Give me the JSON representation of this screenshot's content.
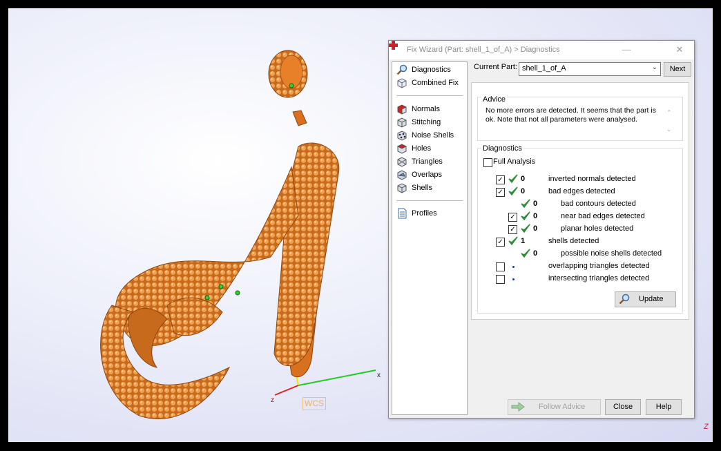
{
  "viewport": {
    "axis_x_label": "x",
    "axis_z_label": "z",
    "wcs_label": "WCS",
    "corner_label": "Z"
  },
  "dialog": {
    "title": "Fix Wizard (Part: shell_1_of_A) > Diagnostics",
    "minimize": "—",
    "close": "✕",
    "nav": [
      {
        "label": "Diagnostics",
        "icon": "magnifier-icon"
      },
      {
        "label": "Combined Fix",
        "icon": "cube-icon"
      },
      {
        "label": "Normals",
        "icon": "normals-cube-icon"
      },
      {
        "label": "Stitching",
        "icon": "stitching-cube-icon"
      },
      {
        "label": "Noise Shells",
        "icon": "noise-shells-icon"
      },
      {
        "label": "Holes",
        "icon": "holes-cube-icon"
      },
      {
        "label": "Triangles",
        "icon": "triangles-icon"
      },
      {
        "label": "Overlaps",
        "icon": "overlaps-icon"
      },
      {
        "label": "Shells",
        "icon": "shells-icon"
      },
      {
        "label": "Profiles",
        "icon": "document-icon"
      }
    ],
    "current_part_label": "Current Part:",
    "current_part_value": "shell_1_of_A",
    "next_button": "Next",
    "advice": {
      "title": "Advice",
      "text": "No more errors are detected. It seems that the part is ok. Note that not all parameters were analysed."
    },
    "diagnostics": {
      "title": "Diagnostics",
      "full_analysis_label": "Full Analysis",
      "full_analysis_checked": false,
      "rows": [
        {
          "checkbox": true,
          "checked": true,
          "status": "ok",
          "count": "0",
          "label": "inverted normals detected",
          "indent": 0
        },
        {
          "checkbox": true,
          "checked": true,
          "status": "ok",
          "count": "0",
          "label": "bad edges detected",
          "indent": 0
        },
        {
          "checkbox": false,
          "checked": false,
          "status": "ok",
          "count": "0",
          "label": "bad contours detected",
          "indent": 1
        },
        {
          "checkbox": true,
          "checked": true,
          "status": "ok",
          "count": "0",
          "label": "near bad edges detected",
          "indent": 1
        },
        {
          "checkbox": true,
          "checked": true,
          "status": "ok",
          "count": "0",
          "label": "planar holes detected",
          "indent": 1
        },
        {
          "checkbox": true,
          "checked": true,
          "status": "ok",
          "count": "1",
          "label": "shells detected",
          "indent": 0
        },
        {
          "checkbox": false,
          "checked": false,
          "status": "ok",
          "count": "0",
          "label": "possible noise shells detected",
          "indent": 1
        },
        {
          "checkbox": true,
          "checked": false,
          "status": "none",
          "count": "",
          "label": "overlapping triangles detected",
          "indent": 0
        },
        {
          "checkbox": true,
          "checked": false,
          "status": "none",
          "count": "",
          "label": "intersecting triangles detected",
          "indent": 0
        }
      ],
      "update_button": "Update"
    },
    "follow_advice_button": "Follow Advice",
    "close_button": "Close",
    "help_button": "Help"
  },
  "colors": {
    "model_orange": "#e8802a",
    "check_green": "#2e8b3a",
    "title_red": "#d0202a"
  }
}
